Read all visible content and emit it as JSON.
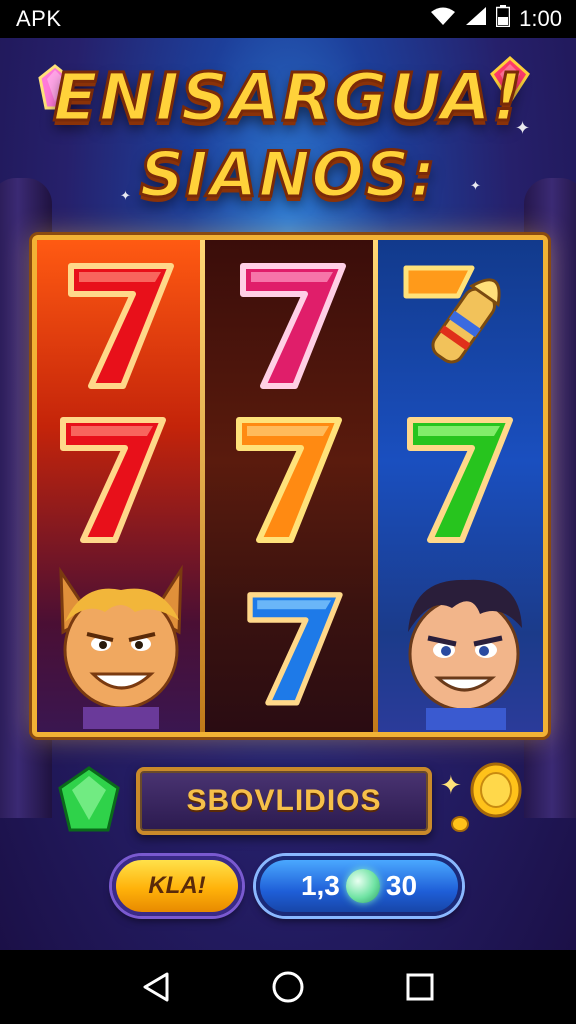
{
  "status_bar": {
    "app_label": "APK",
    "time": "1:00",
    "icons": [
      "wifi-icon",
      "signal-icon",
      "battery-icon"
    ]
  },
  "title": {
    "line1": "ENISARGUA!",
    "line2": "SIANOS:"
  },
  "reels": [
    {
      "symbols": [
        "red-seven",
        "red-seven",
        "cat-character"
      ]
    },
    {
      "symbols": [
        "pink-seven",
        "orange-seven",
        "blue-seven"
      ]
    },
    {
      "symbols": [
        "rocket-seven",
        "green-seven",
        "boy-character"
      ]
    }
  ],
  "message_box": {
    "text": "SBOVLIDIOS"
  },
  "spin_button": {
    "label": "KLA!"
  },
  "balance": {
    "left": "1,3",
    "right": "30"
  },
  "colors": {
    "accent_gold": "#f2b235",
    "title_yellow": "#ffd23a",
    "balance_blue": "#1f5fd8",
    "spin_yellow": "#ffb20a"
  },
  "nav": {
    "icons": [
      "back-icon",
      "home-icon",
      "recents-icon"
    ]
  }
}
